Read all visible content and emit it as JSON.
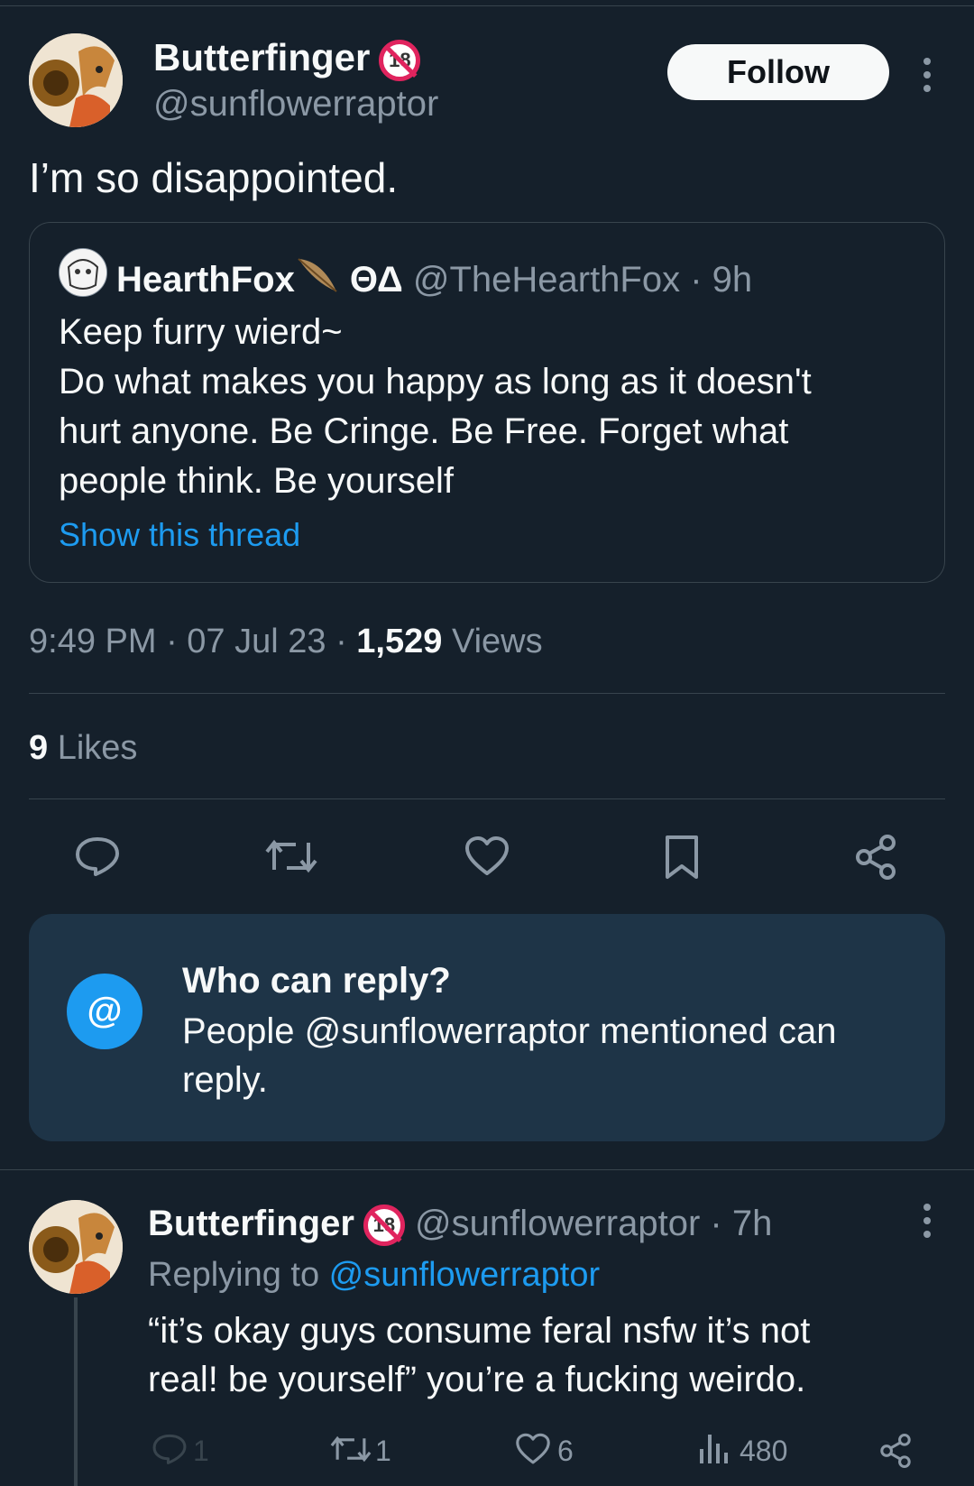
{
  "tweet": {
    "author_name": "Butterfinger",
    "author_handle": "@sunflowerraptor",
    "badge_label": "18",
    "follow_label": "Follow",
    "text": "I’m so disappointed.",
    "timestamp": "9:49 PM · 07 Jul 23 · ",
    "views_count": "1,529",
    "views_label": " Views",
    "likes_count": "9",
    "likes_label": " Likes"
  },
  "quote": {
    "author_name": "HearthFox",
    "author_extra": " ΘΔ",
    "author_handle": " @TheHearthFox · 9h",
    "line1": "Keep furry wierd~",
    "line2": "Do what makes you happy as long as it doesn't",
    "line3": "hurt anyone. Be Cringe. Be Free. Forget what",
    "line4": "people think. Be yourself",
    "show_thread": "Show this thread"
  },
  "actions": {
    "icons": [
      "reply-icon",
      "retweet-icon",
      "like-icon",
      "bookmark-icon",
      "share-icon"
    ]
  },
  "who_can_reply": {
    "icon_label": "@",
    "title": "Who can reply?",
    "line1": "People @sunflowerraptor mentioned can",
    "line2": "reply."
  },
  "reply": {
    "author_name": "Butterfinger",
    "badge_label": "18",
    "author_handle": " @sunflowerraptor · 7h",
    "replying_prefix": "Replying to ",
    "replying_handle": "@sunflowerraptor",
    "line1": "“it’s okay guys consume feral nsfw it’s not",
    "line2": "real! be yourself” you’re a fucking weirdo.",
    "reply_count": "1",
    "retweet_count": "1",
    "like_count": "6",
    "view_count": "480"
  },
  "colors": {
    "background": "#15202b",
    "accent": "#1d9bf0",
    "muted": "#8b98a5",
    "badge": "#e0245e"
  }
}
